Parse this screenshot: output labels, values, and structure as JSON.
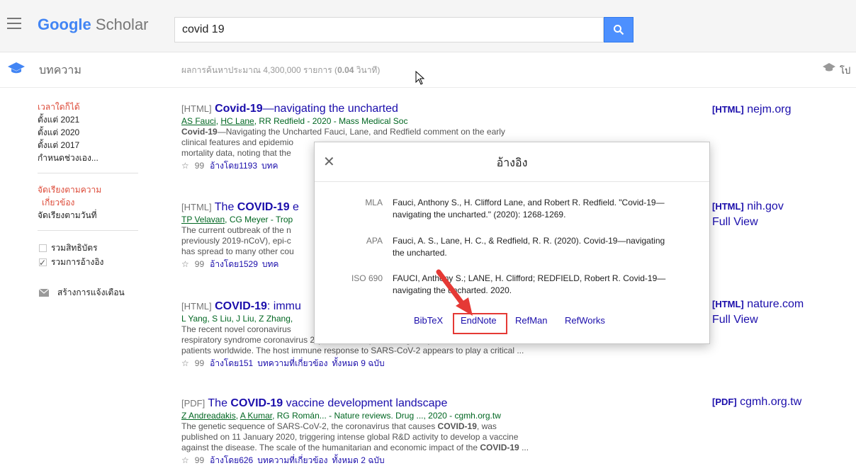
{
  "header": {
    "logo_google": "Google",
    "logo_scholar": "Scholar",
    "search_value": "covid 19"
  },
  "subbar": {
    "section": "บทความ",
    "results_prefix": "ผลการค้นหาประมาณ 4,300,000 รายการ (",
    "results_time": "0.04",
    "results_suffix": " วินาที)",
    "right_text": "โป"
  },
  "sidebar": {
    "time_items": [
      "เวลาใดก็ได้",
      "ตั้งแต่ 2021",
      "ตั้งแต่ 2020",
      "ตั้งแต่ 2017",
      "กำหนดช่วงเอง..."
    ],
    "sort_items": [
      "จัดเรียงตามความ",
      "เกี่ยวข้อง",
      "จัดเรียงตามวันที่"
    ],
    "check_patents": "รวมสิทธิบัตร",
    "check_citations": "รวมการอ้างอิง",
    "create_alert": "สร้างการแจ้งเตือน"
  },
  "results": [
    {
      "tag": "[HTML]",
      "title_bold": "Covid-19",
      "title_rest": "—navigating the uncharted",
      "authors_linked": [
        "AS Fauci",
        "HC Lane"
      ],
      "authors_rest": ", RR Redfield - 2020 - Mass Medical Soc",
      "snippet": [
        "Covid-19—Navigating the Uncharted Fauci, Lane, and Redfield comment on the early",
        "clinical features and epidemio",
        "mortality data, noting that the"
      ],
      "cited": "อ้างโดย1193",
      "more": "บทค",
      "side_tag": "[HTML]",
      "side_domain": "nejm.org",
      "side_extra": ""
    },
    {
      "tag": "[HTML]",
      "title_pre": "The ",
      "title_bold": "COVID-19",
      "title_rest": " e",
      "authors_linked": [
        "TP Velavan"
      ],
      "authors_rest": ", CG Meyer - Trop",
      "snippet": [
        "The current outbreak of the n",
        "previously 2019-nCoV), epi-c",
        "has spread to many other cou"
      ],
      "cited": "อ้างโดย1529",
      "more": "บทค",
      "side_tag": "[HTML]",
      "side_domain": "nih.gov",
      "side_extra": "Full View"
    },
    {
      "tag": "[HTML]",
      "title_bold": "COVID-19",
      "title_rest": ": immu",
      "authors_text": "L Yang, S Liu, J Liu, Z Zhang,",
      "snippet": [
        "The recent novel coronavirus",
        "respiratory syndrome coronavirus 2 (SARS-CoV-2), is seeing a rapid increase in infected",
        "patients worldwide. The host immune response to SARS-CoV-2 appears to play a critical ..."
      ],
      "cited": "อ้างโดย151",
      "related": "บทความที่เกี่ยวข้อง",
      "versions": "ทั้งหมด 9 ฉบับ",
      "side_tag": "[HTML]",
      "side_domain": "nature.com",
      "side_extra": "Full View"
    },
    {
      "tag": "[PDF]",
      "title_pre": "The ",
      "title_bold": "COVID-19",
      "title_rest": " vaccine development landscape",
      "authors_linked": [
        "Z Andreadakis",
        "A Kumar"
      ],
      "authors_rest": ", RG Román... - Nature reviews. Drug ..., 2020 - cgmh.org.tw",
      "snippet_1": "The genetic sequence of SARS-CoV-2, the coronavirus that causes ",
      "snippet_1b": "COVID-19",
      "snippet_1c": ", was",
      "snippet_2": "published on 11 January 2020, triggering intense global R&D activity to develop a vaccine",
      "snippet_3": "against the disease. The scale of the humanitarian and economic impact of the ",
      "snippet_3b": "COVID-19",
      "snippet_3c": " ...",
      "cited": "อ้างโดย626",
      "related": "บทความที่เกี่ยวข้อง",
      "versions": "ทั้งหมด 2 ฉบับ",
      "side_tag": "[PDF]",
      "side_domain": "cgmh.org.tw"
    }
  ],
  "dialog": {
    "title": "อ้างอิง",
    "citations": [
      {
        "style": "MLA",
        "text": "Fauci, Anthony S., H. Clifford Lane, and Robert R. Redfield. \"Covid-19—navigating the uncharted.\" (2020): 1268-1269."
      },
      {
        "style": "APA",
        "text": "Fauci, A. S., Lane, H. C., & Redfield, R. R. (2020). Covid-19—navigating the uncharted."
      },
      {
        "style": "ISO 690",
        "text": "FAUCI, Anthony S.; LANE, H. Clifford; REDFIELD, Robert R. Covid-19—navigating the uncharted. 2020."
      }
    ],
    "exports": [
      "BibTeX",
      "EndNote",
      "RefMan",
      "RefWorks"
    ]
  },
  "colors": {
    "link": "#1a0dab",
    "authors": "#006621",
    "active": "#dd4b39",
    "search_button": "#4d90fe",
    "highlight": "#e53935"
  },
  "icons": [
    "menu-icon",
    "search-icon",
    "scholar-cap-icon",
    "mail-icon",
    "star-icon",
    "quote-icon",
    "close-icon"
  ]
}
